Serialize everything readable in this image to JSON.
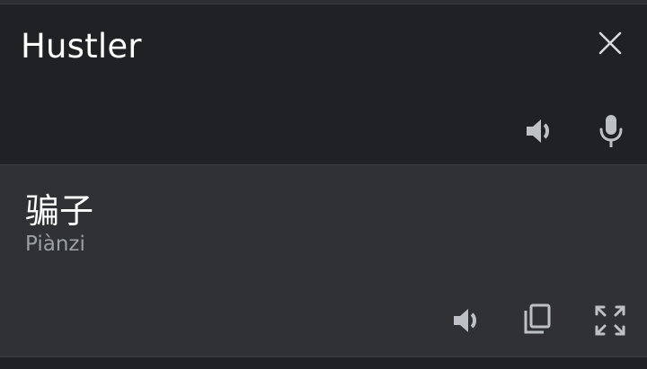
{
  "source": {
    "text": "Hustler",
    "icons": {
      "close": "close-icon",
      "speaker": "volume-icon",
      "mic": "mic-icon"
    }
  },
  "result": {
    "text": "骗子",
    "romanization": "Piànzi",
    "icons": {
      "speaker": "volume-icon",
      "copy": "copy-icon",
      "fullscreen": "fullscreen-icon"
    }
  },
  "colors": {
    "background": "#202124",
    "card": "#303134",
    "text_primary": "#ffffff",
    "text_secondary": "#9aa0a6",
    "icon": "#bdc1c6"
  }
}
